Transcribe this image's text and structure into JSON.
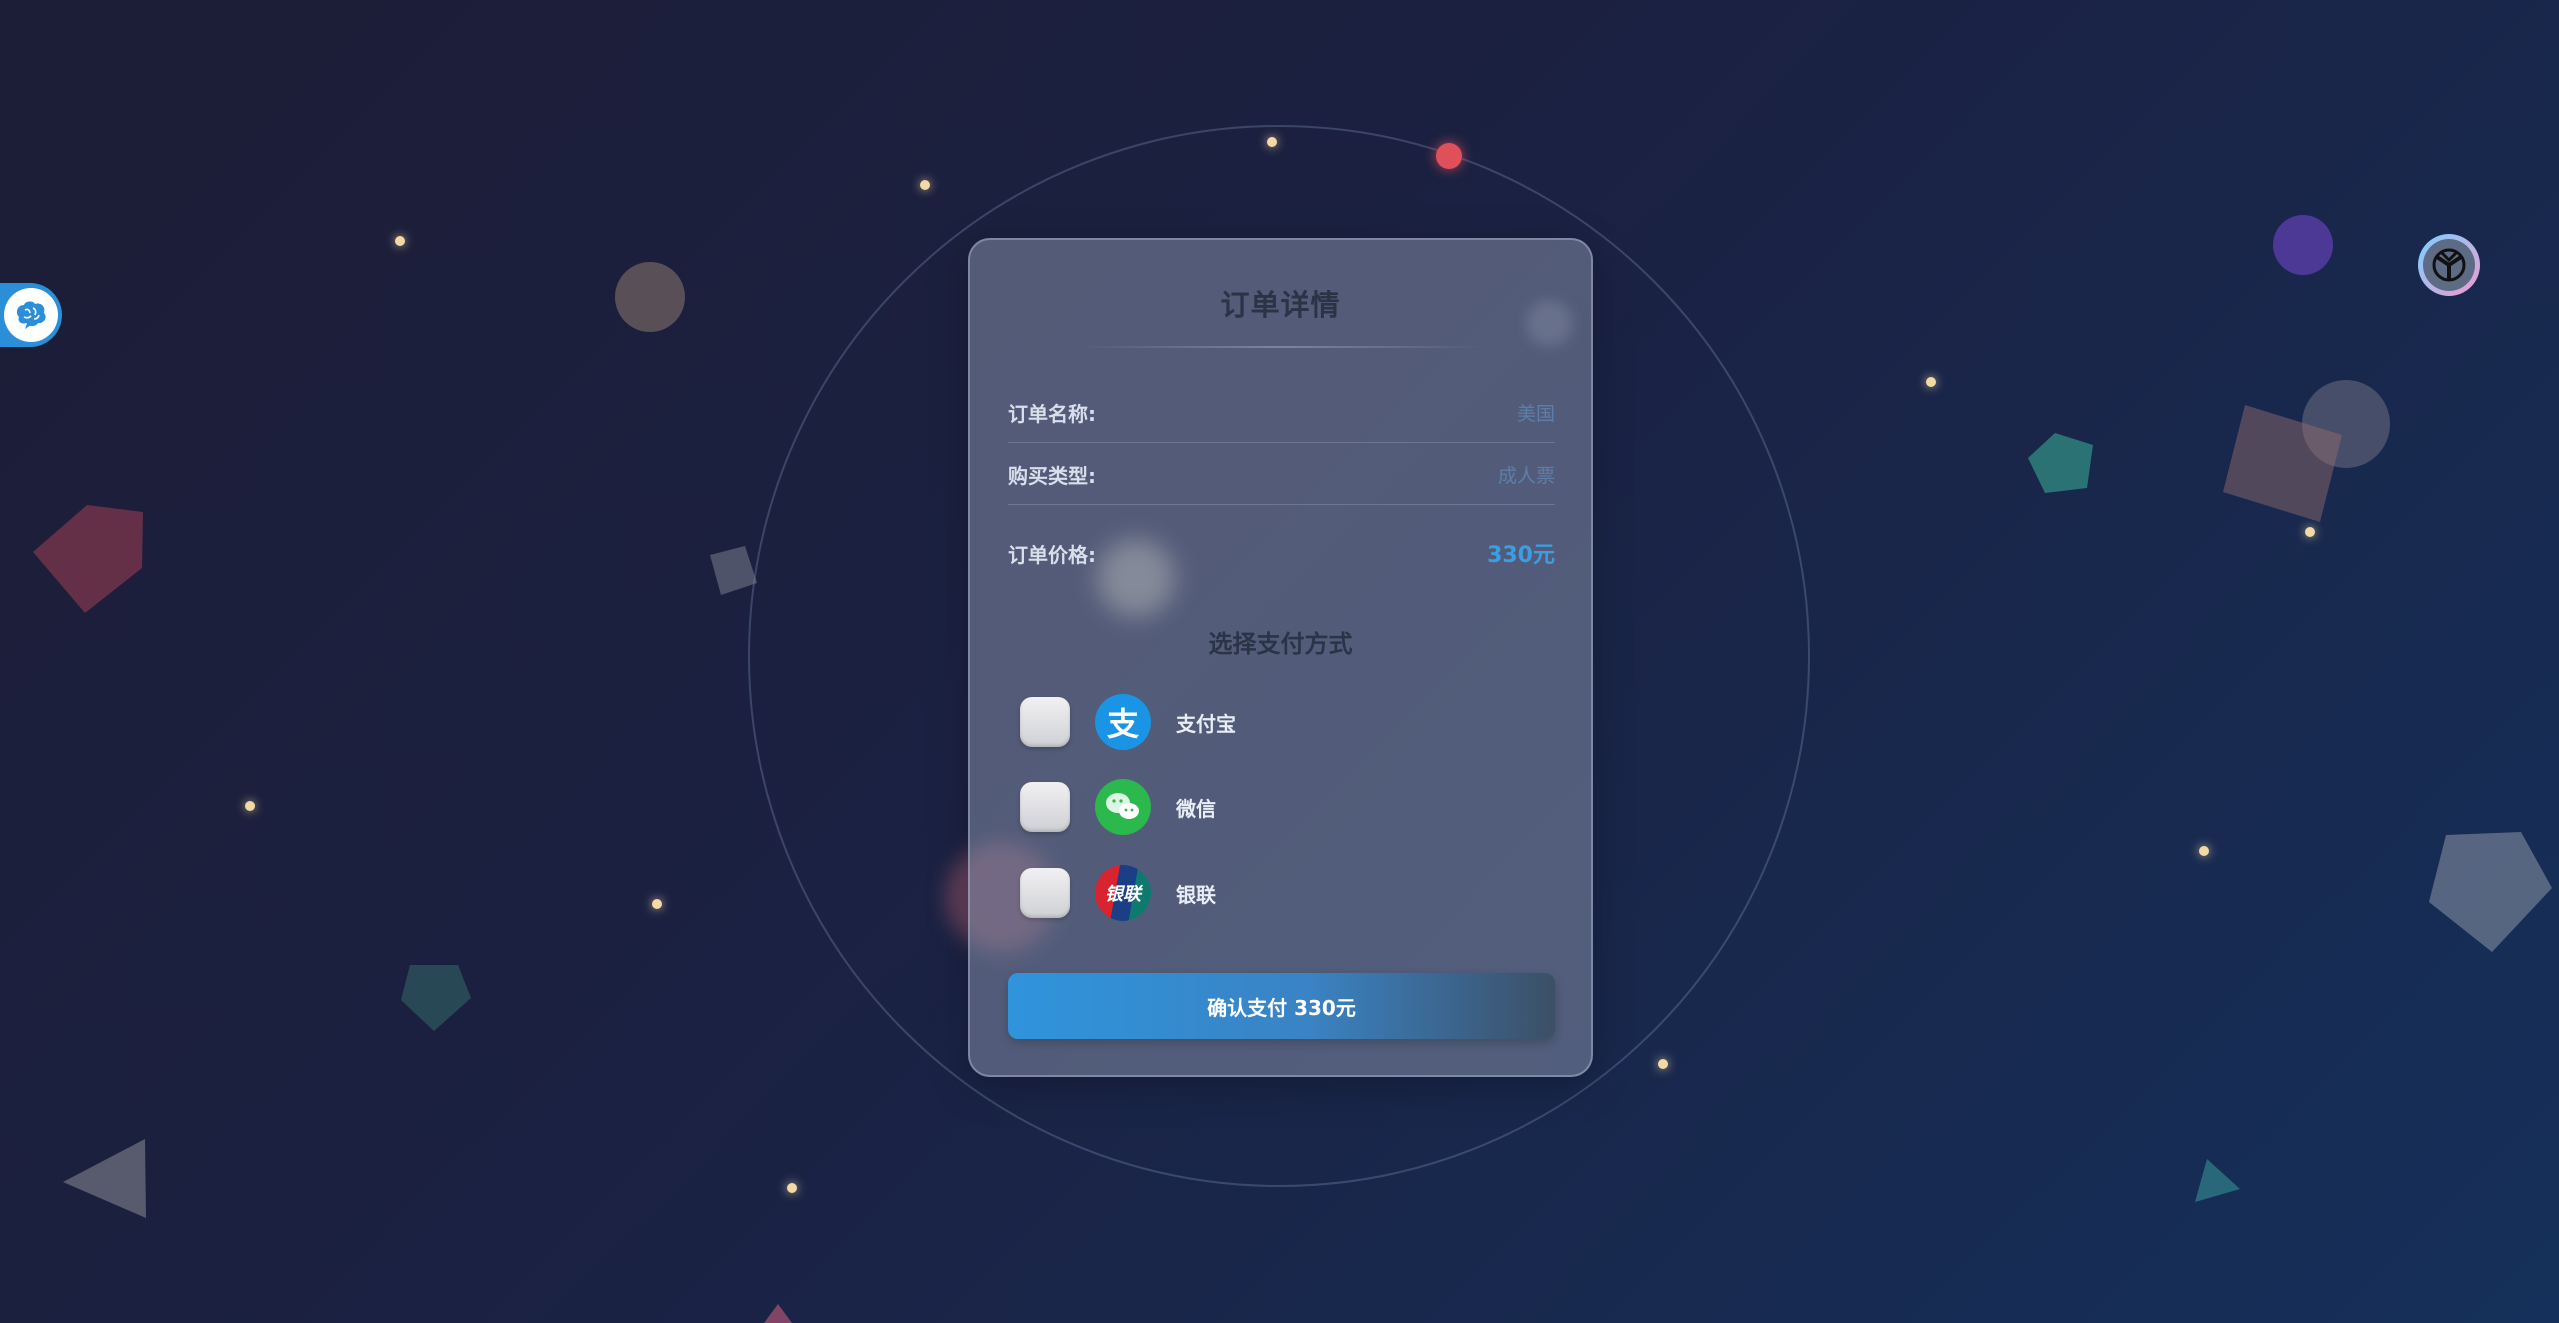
{
  "card": {
    "title": "订单详情",
    "rows": [
      {
        "label": "订单名称:",
        "value": "美国"
      },
      {
        "label": "购买类型:",
        "value": "成人票"
      },
      {
        "label": "订单价格:",
        "value": "330元"
      }
    ],
    "payment_section_title": "选择支付方式",
    "payment_options": [
      {
        "label": "支付宝",
        "icon": "alipay-icon",
        "color": "#1a95e6",
        "glyph": "支"
      },
      {
        "label": "微信",
        "icon": "wechat-icon",
        "color": "#2bb84c"
      },
      {
        "label": "银联",
        "icon": "unionpay-icon",
        "glyph": "银联"
      }
    ],
    "confirm_label": "确认支付 330元"
  },
  "widgets": {
    "left": "brain-icon",
    "right": "avatar-icon"
  },
  "colors": {
    "accent": "#3a9ee0",
    "card_bg": "#828ca5",
    "page_bg_start": "#1c1d36",
    "page_bg_end": "#15305a"
  }
}
